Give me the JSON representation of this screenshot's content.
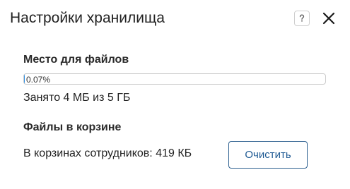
{
  "dialog": {
    "title": "Настройки хранилища",
    "help_icon": "question-mark-icon",
    "close_icon": "close-x-icon"
  },
  "storage": {
    "section_title": "Место для файлов",
    "progress_value": 0.0007,
    "progress_text": "0.07%",
    "usage_text": "Занято 4 МБ из 5 ГБ"
  },
  "trash": {
    "section_title": "Файлы в корзине",
    "info_text": "В корзинах сотрудников: 419 КБ",
    "clear_button_label": "Очистить"
  },
  "colors": {
    "accent": "#1f5a93",
    "progress_fill": "#2f8ee0"
  }
}
